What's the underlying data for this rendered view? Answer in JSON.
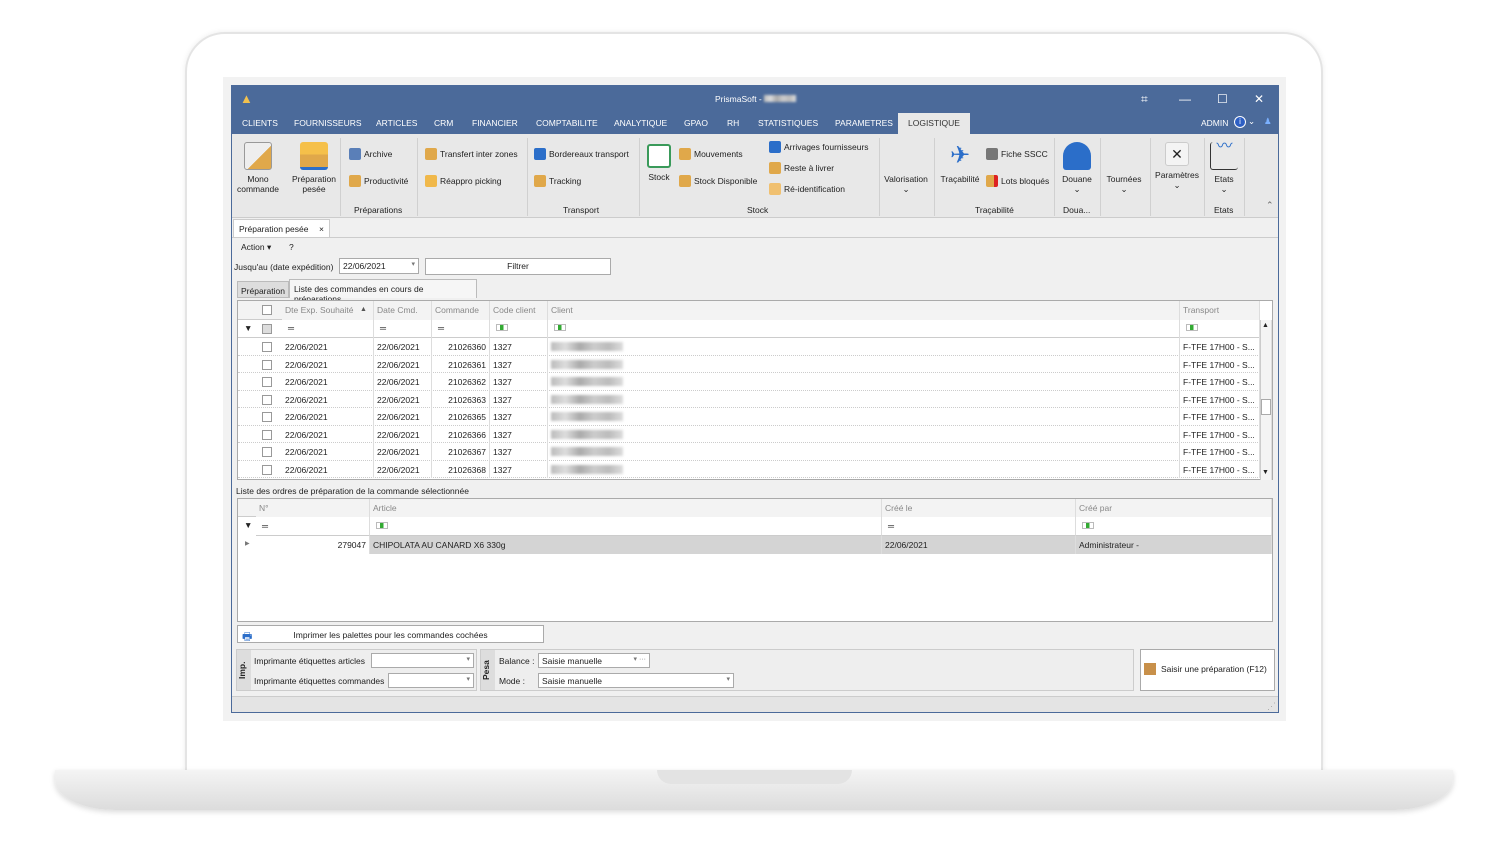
{
  "window": {
    "title": "PrismaSoft - ",
    "user": "ADMIN"
  },
  "menu": [
    "CLIENTS",
    "FOURNISSEURS",
    "ARTICLES",
    "CRM",
    "FINANCIER",
    "COMPTABILITE",
    "ANALYTIQUE",
    "GPAO",
    "RH",
    "STATISTIQUES",
    "PARAMETRES",
    "LOGISTIQUE"
  ],
  "ribbon": {
    "mono": "Mono commande",
    "prep_pesee": "Préparation pesée",
    "archive": "Archive",
    "productivite": "Productivité",
    "transfert": "Transfert inter zones",
    "reappro": "Réappro picking",
    "bordereaux": "Bordereaux transport",
    "tracking": "Tracking",
    "stock": "Stock",
    "mouvements": "Mouvements",
    "stock_dispo": "Stock Disponible",
    "arrivages": "Arrivages fournisseurs",
    "reste": "Reste à livrer",
    "reident": "Ré-identification",
    "valorisation": "Valorisation",
    "tracabilite": "Traçabilité",
    "sscc": "Fiche SSCC",
    "lots": "Lots bloqués",
    "douane": "Douane",
    "tournees": "Tournées",
    "parametres": "Paramètres",
    "etats": "Etats",
    "groups": {
      "preparations": "Préparations",
      "transport": "Transport",
      "stock": "Stock",
      "tracabilite": "Traçabilité",
      "douane": "Doua...",
      "etats": "Etats"
    }
  },
  "doc_tab": "Préparation pesée",
  "toolbar": {
    "action": "Action",
    "help": "?"
  },
  "filter": {
    "label": "Jusqu'au (date expédition)",
    "date": "22/06/2021",
    "button": "Filtrer"
  },
  "tabs": [
    "Préparation",
    "Liste des commandes en cours de préparations"
  ],
  "orders": {
    "columns": [
      "Dte Exp. Souhaité",
      "Date Cmd.",
      "Commande",
      "Code client",
      "Client",
      "Transport"
    ],
    "rows": [
      [
        "22/06/2021",
        "22/06/2021",
        "21026360",
        "1327",
        "",
        "F-TFE 17H00 - S..."
      ],
      [
        "22/06/2021",
        "22/06/2021",
        "21026361",
        "1327",
        "",
        "F-TFE 17H00 - S..."
      ],
      [
        "22/06/2021",
        "22/06/2021",
        "21026362",
        "1327",
        "",
        "F-TFE 17H00 - S..."
      ],
      [
        "22/06/2021",
        "22/06/2021",
        "21026363",
        "1327",
        "",
        "F-TFE 17H00 - S..."
      ],
      [
        "22/06/2021",
        "22/06/2021",
        "21026365",
        "1327",
        "",
        "F-TFE 17H00 - S..."
      ],
      [
        "22/06/2021",
        "22/06/2021",
        "21026366",
        "1327",
        "",
        "F-TFE 17H00 - S..."
      ],
      [
        "22/06/2021",
        "22/06/2021",
        "21026367",
        "1327",
        "",
        "F-TFE 17H00 - S..."
      ],
      [
        "22/06/2021",
        "22/06/2021",
        "21026368",
        "1327",
        "",
        "F-TFE 17H00 - S..."
      ]
    ]
  },
  "prep_orders": {
    "label": "Liste des ordres de préparation de la commande sélectionnée",
    "columns": [
      "N°",
      "Article",
      "Créé le",
      "Créé par"
    ],
    "rows": [
      [
        "279047",
        "CHIPOLATA AU CANARD X6 330g",
        "22/06/2021",
        "Administrateur -"
      ]
    ]
  },
  "print_button": "Imprimer les palettes pour les commandes cochées",
  "imp": {
    "tag": "Imp.",
    "articles_label": "Imprimante étiquettes articles",
    "commandes_label": "Imprimante étiquettes commandes",
    "articles_value": "",
    "commandes_value": ""
  },
  "pesa": {
    "tag": "Pesa",
    "balance_label": "Balance :",
    "balance_value": "Saisie manuelle",
    "mode_label": "Mode :",
    "mode_value": "Saisie manuelle"
  },
  "saisir_button": "Saisir une préparation (F12)",
  "colors": {
    "titlebar": "#4b6a9a",
    "ribbon": "#e8e8e8",
    "selected_row": "#d4d4d4"
  }
}
